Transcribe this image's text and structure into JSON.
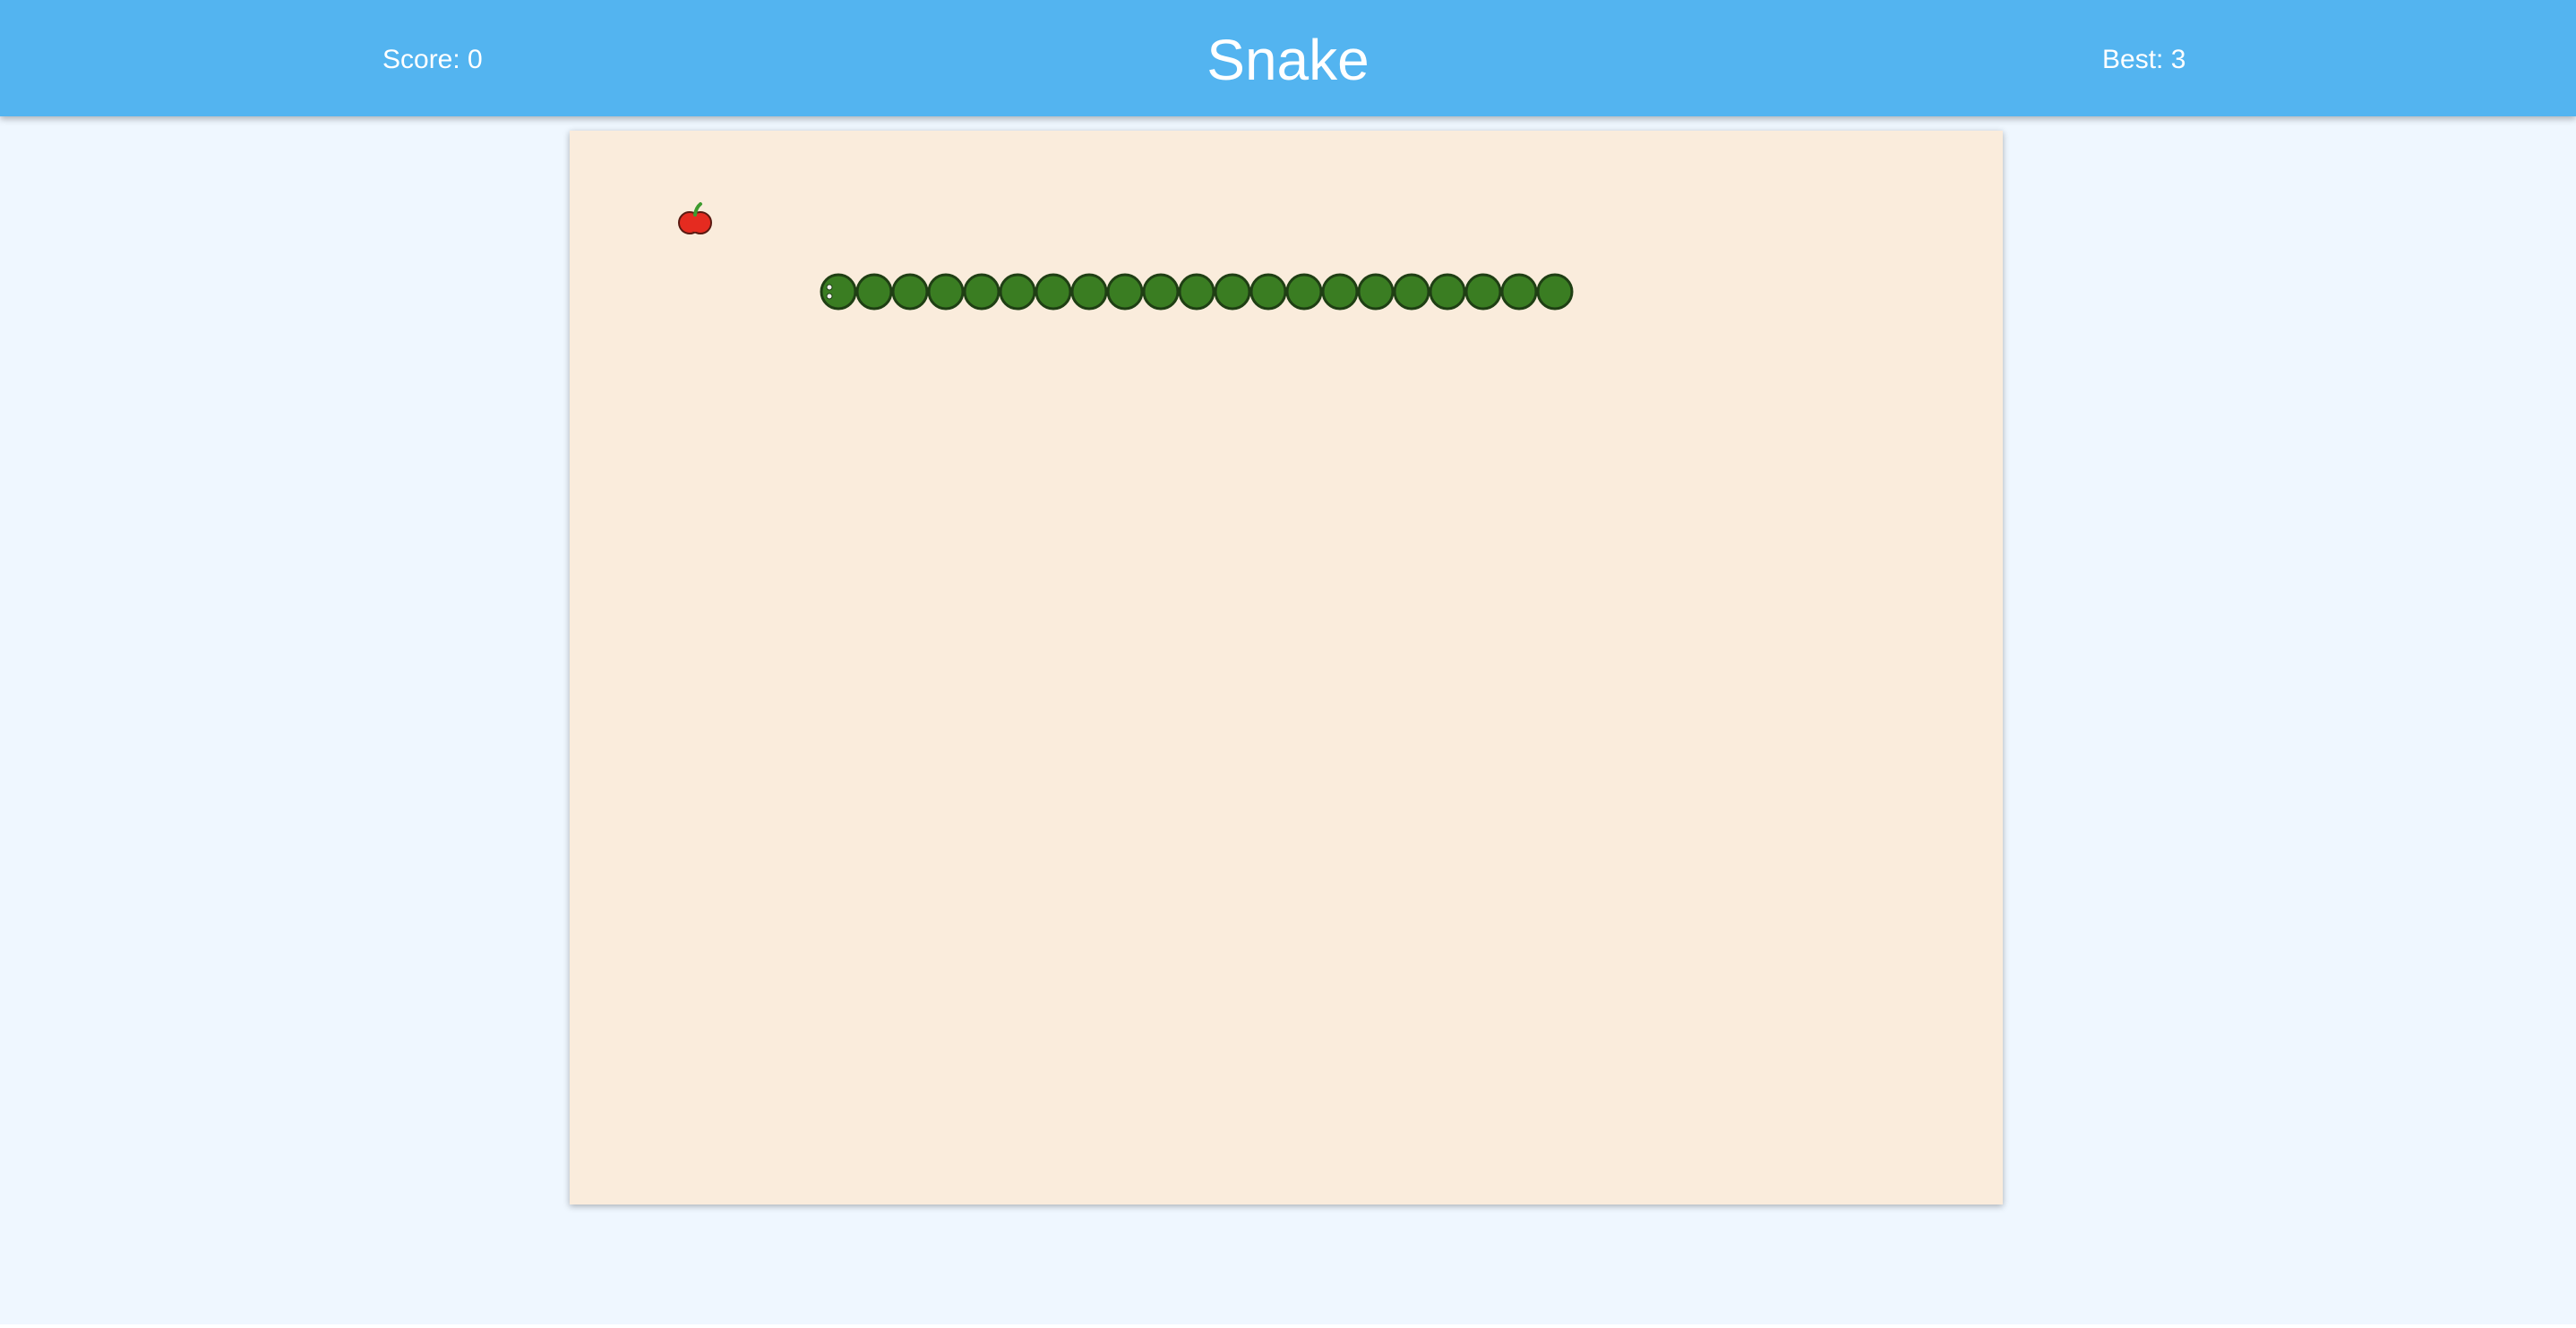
{
  "header": {
    "score_label": "Score: 0",
    "title": "Snake",
    "best_label": "Best: 3"
  },
  "game": {
    "score": 0,
    "best": 3,
    "grid_columns": 40,
    "grid_rows": 30,
    "direction": "left",
    "food": {
      "type": "apple",
      "col": 3,
      "row": 2
    },
    "snake": [
      {
        "col": 7,
        "row": 4
      },
      {
        "col": 8,
        "row": 4
      },
      {
        "col": 9,
        "row": 4
      },
      {
        "col": 10,
        "row": 4
      },
      {
        "col": 11,
        "row": 4
      },
      {
        "col": 12,
        "row": 4
      },
      {
        "col": 13,
        "row": 4
      },
      {
        "col": 14,
        "row": 4
      },
      {
        "col": 15,
        "row": 4
      },
      {
        "col": 16,
        "row": 4
      },
      {
        "col": 17,
        "row": 4
      },
      {
        "col": 18,
        "row": 4
      },
      {
        "col": 19,
        "row": 4
      },
      {
        "col": 20,
        "row": 4
      },
      {
        "col": 21,
        "row": 4
      },
      {
        "col": 22,
        "row": 4
      },
      {
        "col": 23,
        "row": 4
      },
      {
        "col": 24,
        "row": 4
      },
      {
        "col": 25,
        "row": 4
      },
      {
        "col": 26,
        "row": 4
      },
      {
        "col": 27,
        "row": 4
      }
    ]
  },
  "colors": {
    "header_bg": "#53b4f0",
    "page_bg": "#eff7ff",
    "board_bg": "#faecdc",
    "snake_fill": "#3a7d22",
    "snake_outline": "#1f3f14",
    "apple_red": "#e52b20",
    "apple_stem": "#3d9b2f"
  },
  "icons": {
    "food": "apple-icon",
    "head": "snake-head-icon"
  }
}
